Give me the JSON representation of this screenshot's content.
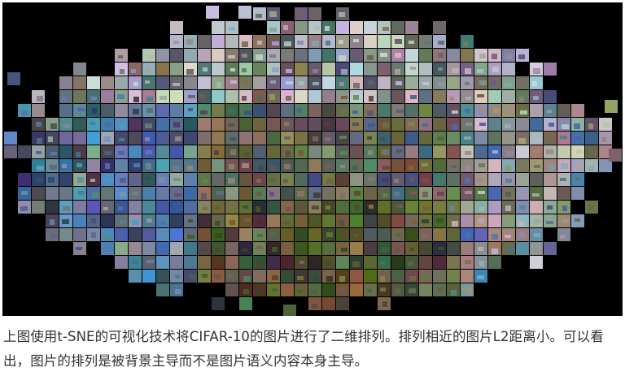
{
  "figure": {
    "description_icon": "tsne-cifar10-image-cloud",
    "background_color": "#000000"
  },
  "caption": {
    "text": "上图使用t-SNE的可视化技术将CIFAR-10的图片进行了二维排列。排列相近的图片L2距离小。可以看出，图片的排列是被背景主导而不是图片语义内容本身主导。"
  }
}
